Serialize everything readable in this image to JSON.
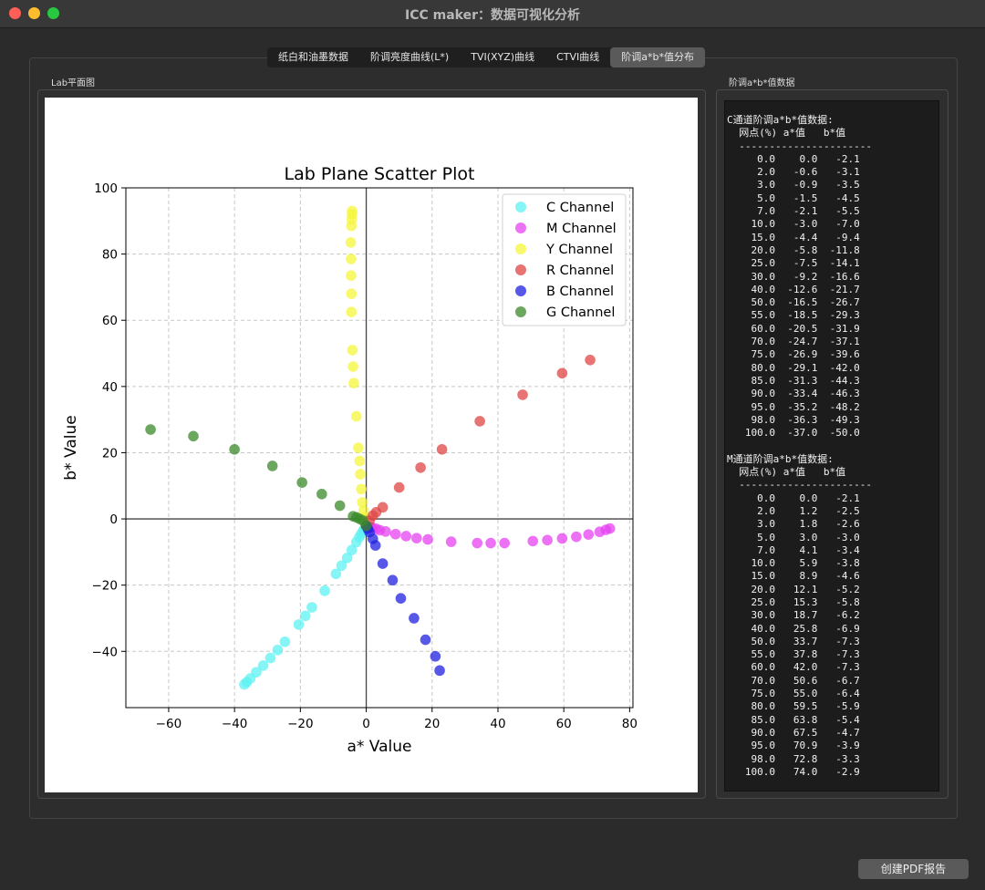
{
  "window": {
    "title": "ICC maker：数据可视化分析"
  },
  "tabs": [
    {
      "label": "纸白和油墨数据",
      "active": false
    },
    {
      "label": "阶调亮度曲线(L*)",
      "active": false
    },
    {
      "label": "TVI(XYZ)曲线",
      "active": false
    },
    {
      "label": "CTVI曲线",
      "active": false
    },
    {
      "label": "阶调a*b*值分布",
      "active": true
    }
  ],
  "left_group": {
    "label": "Lab平面图"
  },
  "right_group": {
    "label": "阶调a*b*值数据"
  },
  "data_text": {
    "c_header": "C通道阶调a*b*值数据:",
    "m_header": "M通道阶调a*b*值数据:",
    "column_header": "  网点(%) a*值   b*值",
    "separator": "  ----------------------",
    "c_rows": [
      [
        "0.0",
        "0.0",
        "-2.1"
      ],
      [
        "2.0",
        "-0.6",
        "-3.1"
      ],
      [
        "3.0",
        "-0.9",
        "-3.5"
      ],
      [
        "5.0",
        "-1.5",
        "-4.5"
      ],
      [
        "7.0",
        "-2.1",
        "-5.5"
      ],
      [
        "10.0",
        "-3.0",
        "-7.0"
      ],
      [
        "15.0",
        "-4.4",
        "-9.4"
      ],
      [
        "20.0",
        "-5.8",
        "-11.8"
      ],
      [
        "25.0",
        "-7.5",
        "-14.1"
      ],
      [
        "30.0",
        "-9.2",
        "-16.6"
      ],
      [
        "40.0",
        "-12.6",
        "-21.7"
      ],
      [
        "50.0",
        "-16.5",
        "-26.7"
      ],
      [
        "55.0",
        "-18.5",
        "-29.3"
      ],
      [
        "60.0",
        "-20.5",
        "-31.9"
      ],
      [
        "70.0",
        "-24.7",
        "-37.1"
      ],
      [
        "75.0",
        "-26.9",
        "-39.6"
      ],
      [
        "80.0",
        "-29.1",
        "-42.0"
      ],
      [
        "85.0",
        "-31.3",
        "-44.3"
      ],
      [
        "90.0",
        "-33.4",
        "-46.3"
      ],
      [
        "95.0",
        "-35.2",
        "-48.2"
      ],
      [
        "98.0",
        "-36.3",
        "-49.3"
      ],
      [
        "100.0",
        "-37.0",
        "-50.0"
      ]
    ],
    "m_rows": [
      [
        "0.0",
        "0.0",
        "-2.1"
      ],
      [
        "2.0",
        "1.2",
        "-2.5"
      ],
      [
        "3.0",
        "1.8",
        "-2.6"
      ],
      [
        "5.0",
        "3.0",
        "-3.0"
      ],
      [
        "7.0",
        "4.1",
        "-3.4"
      ],
      [
        "10.0",
        "5.9",
        "-3.8"
      ],
      [
        "15.0",
        "8.9",
        "-4.6"
      ],
      [
        "20.0",
        "12.1",
        "-5.2"
      ],
      [
        "25.0",
        "15.3",
        "-5.8"
      ],
      [
        "30.0",
        "18.7",
        "-6.2"
      ],
      [
        "40.0",
        "25.8",
        "-6.9"
      ],
      [
        "50.0",
        "33.7",
        "-7.3"
      ],
      [
        "55.0",
        "37.8",
        "-7.3"
      ],
      [
        "60.0",
        "42.0",
        "-7.3"
      ],
      [
        "70.0",
        "50.6",
        "-6.7"
      ],
      [
        "75.0",
        "55.0",
        "-6.4"
      ],
      [
        "80.0",
        "59.5",
        "-5.9"
      ],
      [
        "85.0",
        "63.8",
        "-5.4"
      ],
      [
        "90.0",
        "67.5",
        "-4.7"
      ],
      [
        "95.0",
        "70.9",
        "-3.9"
      ],
      [
        "98.0",
        "72.8",
        "-3.3"
      ],
      [
        "100.0",
        "74.0",
        "-2.9"
      ]
    ]
  },
  "buttons": {
    "create_pdf": "创建PDF报告"
  },
  "chart_data": {
    "type": "scatter",
    "title": "Lab Plane Scatter Plot",
    "xlabel": "a* Value",
    "ylabel": "b* Value",
    "xlim": [
      -73,
      81
    ],
    "ylim": [
      -57,
      100
    ],
    "xticks": [
      -60,
      -40,
      -20,
      0,
      20,
      40,
      60,
      80
    ],
    "yticks": [
      -40,
      -20,
      0,
      20,
      40,
      60,
      80,
      100
    ],
    "grid": true,
    "legend": "top-right",
    "series": [
      {
        "name": "C Channel",
        "color": "#5ef2f2",
        "points": [
          [
            0,
            -2.1
          ],
          [
            -0.6,
            -3.1
          ],
          [
            -0.9,
            -3.5
          ],
          [
            -1.5,
            -4.5
          ],
          [
            -2.1,
            -5.5
          ],
          [
            -3.0,
            -7.0
          ],
          [
            -4.4,
            -9.4
          ],
          [
            -5.8,
            -11.8
          ],
          [
            -7.5,
            -14.1
          ],
          [
            -9.2,
            -16.6
          ],
          [
            -12.6,
            -21.7
          ],
          [
            -16.5,
            -26.7
          ],
          [
            -18.5,
            -29.3
          ],
          [
            -20.5,
            -31.9
          ],
          [
            -24.7,
            -37.1
          ],
          [
            -26.9,
            -39.6
          ],
          [
            -29.1,
            -42.0
          ],
          [
            -31.3,
            -44.3
          ],
          [
            -33.4,
            -46.3
          ],
          [
            -35.2,
            -48.2
          ],
          [
            -36.3,
            -49.3
          ],
          [
            -37.0,
            -50.0
          ]
        ]
      },
      {
        "name": "M Channel",
        "color": "#e642f2",
        "points": [
          [
            0,
            -2.1
          ],
          [
            1.2,
            -2.5
          ],
          [
            1.8,
            -2.6
          ],
          [
            3.0,
            -3.0
          ],
          [
            4.1,
            -3.4
          ],
          [
            5.9,
            -3.8
          ],
          [
            8.9,
            -4.6
          ],
          [
            12.1,
            -5.2
          ],
          [
            15.3,
            -5.8
          ],
          [
            18.7,
            -6.2
          ],
          [
            25.8,
            -6.9
          ],
          [
            33.7,
            -7.3
          ],
          [
            37.8,
            -7.3
          ],
          [
            42.0,
            -7.3
          ],
          [
            50.6,
            -6.7
          ],
          [
            55.0,
            -6.4
          ],
          [
            59.5,
            -5.9
          ],
          [
            63.8,
            -5.4
          ],
          [
            67.5,
            -4.7
          ],
          [
            70.9,
            -3.9
          ],
          [
            72.8,
            -3.3
          ],
          [
            74.0,
            -2.9
          ]
        ]
      },
      {
        "name": "Y Channel",
        "color": "#f5f53a",
        "points": [
          [
            0,
            -2.1
          ],
          [
            -0.5,
            0.5
          ],
          [
            -0.8,
            2.5
          ],
          [
            -1.2,
            5.0
          ],
          [
            -1.5,
            9.0
          ],
          [
            -1.8,
            13.5
          ],
          [
            -2.0,
            17.5
          ],
          [
            -2.4,
            21.5
          ],
          [
            -3.0,
            31.0
          ],
          [
            -3.8,
            41.0
          ],
          [
            -4.0,
            46.0
          ],
          [
            -4.2,
            51.0
          ],
          [
            -4.5,
            62.5
          ],
          [
            -4.5,
            68.0
          ],
          [
            -4.6,
            73.5
          ],
          [
            -4.6,
            78.5
          ],
          [
            -4.7,
            83.5
          ],
          [
            -4.5,
            88.5
          ],
          [
            -4.4,
            90.5
          ],
          [
            -4.3,
            92.0
          ],
          [
            -4.3,
            93.0
          ]
        ]
      },
      {
        "name": "R Channel",
        "color": "#e04444",
        "points": [
          [
            0,
            -2.1
          ],
          [
            1.0,
            -0.5
          ],
          [
            2.0,
            1.0
          ],
          [
            3.0,
            2.0
          ],
          [
            5.0,
            3.5
          ],
          [
            10.0,
            9.5
          ],
          [
            16.5,
            15.5
          ],
          [
            23.0,
            21.0
          ],
          [
            34.5,
            29.5
          ],
          [
            47.5,
            37.5
          ],
          [
            59.5,
            44.0
          ],
          [
            68.0,
            48.0
          ]
        ]
      },
      {
        "name": "B Channel",
        "color": "#2020e0",
        "points": [
          [
            0,
            -2.1
          ],
          [
            0.5,
            -3.0
          ],
          [
            1.0,
            -4.0
          ],
          [
            2.0,
            -6.0
          ],
          [
            2.8,
            -8.0
          ],
          [
            5.0,
            -13.5
          ],
          [
            8.0,
            -18.5
          ],
          [
            10.5,
            -24.0
          ],
          [
            14.5,
            -30.0
          ],
          [
            18.0,
            -36.5
          ],
          [
            21.0,
            -41.5
          ],
          [
            22.3,
            -45.8
          ]
        ]
      },
      {
        "name": "G Channel",
        "color": "#3a8a2a",
        "points": [
          [
            0,
            -2.1
          ],
          [
            -1.0,
            -0.5
          ],
          [
            -2.0,
            0.0
          ],
          [
            -3.0,
            0.5
          ],
          [
            -4.0,
            0.8
          ],
          [
            -8.0,
            4.0
          ],
          [
            -13.5,
            7.5
          ],
          [
            -19.5,
            11.0
          ],
          [
            -28.5,
            16.0
          ],
          [
            -40.0,
            21.0
          ],
          [
            -52.5,
            25.0
          ],
          [
            -65.5,
            27.0
          ]
        ]
      }
    ]
  }
}
